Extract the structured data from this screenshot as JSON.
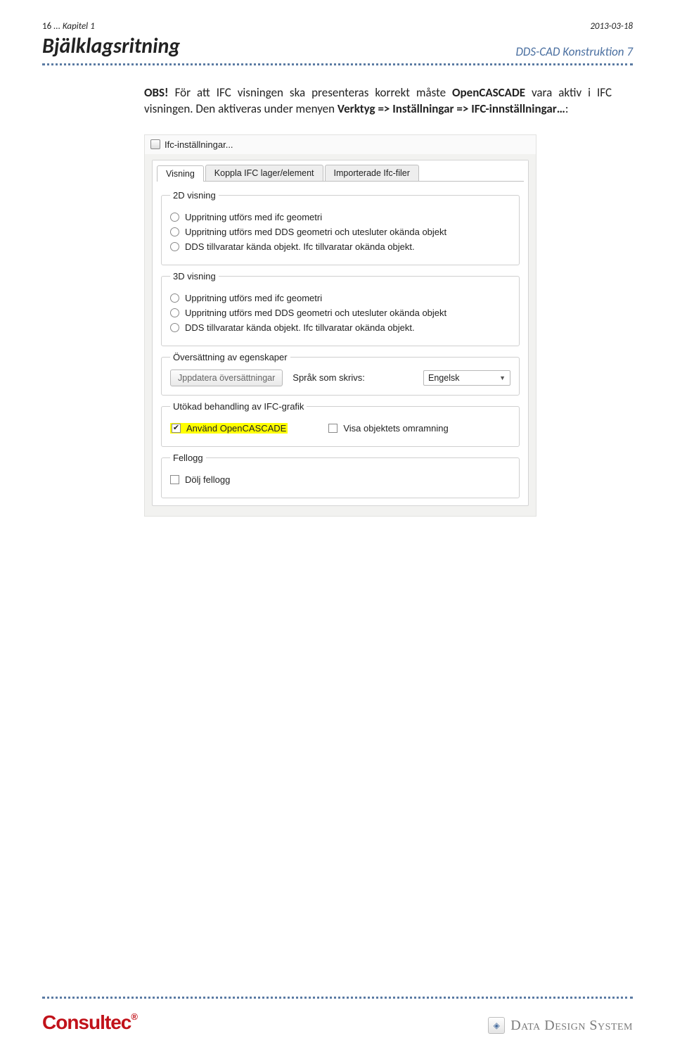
{
  "header": {
    "page_num": "16",
    "chapter": "... Kapitel 1",
    "date": "2013-03-18"
  },
  "title": {
    "left": "Bjälklagsritning",
    "right": "DDS-CAD Konstruktion 7"
  },
  "body": {
    "obs": "OBS!",
    "p1a": " För att IFC visningen ska presenteras korrekt måste ",
    "p1b": "OpenCASCADE",
    "p1c": " vara aktiv i IFC visningen. Den aktiveras under menyen ",
    "p1d": "Verktyg => Inställningar => IFC-innställningar…",
    "p1e": ":"
  },
  "dialog": {
    "title": "Ifc-inställningar...",
    "tabs": [
      "Visning",
      "Koppla IFC lager/element",
      "Importerade Ifc-filer"
    ],
    "groups": {
      "g2d": {
        "legend": "2D visning",
        "opts": [
          "Uppritning utförs med ifc geometri",
          "Uppritning utförs med DDS geometri och utesluter okända objekt",
          "DDS tillvaratar kända objekt. Ifc tillvaratar okända objekt."
        ]
      },
      "g3d": {
        "legend": "3D visning",
        "opts": [
          "Uppritning utförs med ifc geometri",
          "Uppritning utförs med DDS geometri och utesluter okända objekt",
          "DDS tillvaratar kända objekt. Ifc tillvaratar okända objekt."
        ]
      },
      "trans": {
        "legend": "Översättning av egenskaper",
        "btn": "Jppdatera översättningar",
        "label": "Språk som skrivs:",
        "value": "Engelsk"
      },
      "ext": {
        "legend": "Utökad behandling av IFC-grafik",
        "c1": "Använd OpenCASCADE",
        "c2": "Visa objektets omramning"
      },
      "log": {
        "legend": "Fellogg",
        "c1": "Dölj fellogg"
      }
    }
  },
  "footer": {
    "logo1": "Consultec",
    "logo2": "Data Design System"
  }
}
